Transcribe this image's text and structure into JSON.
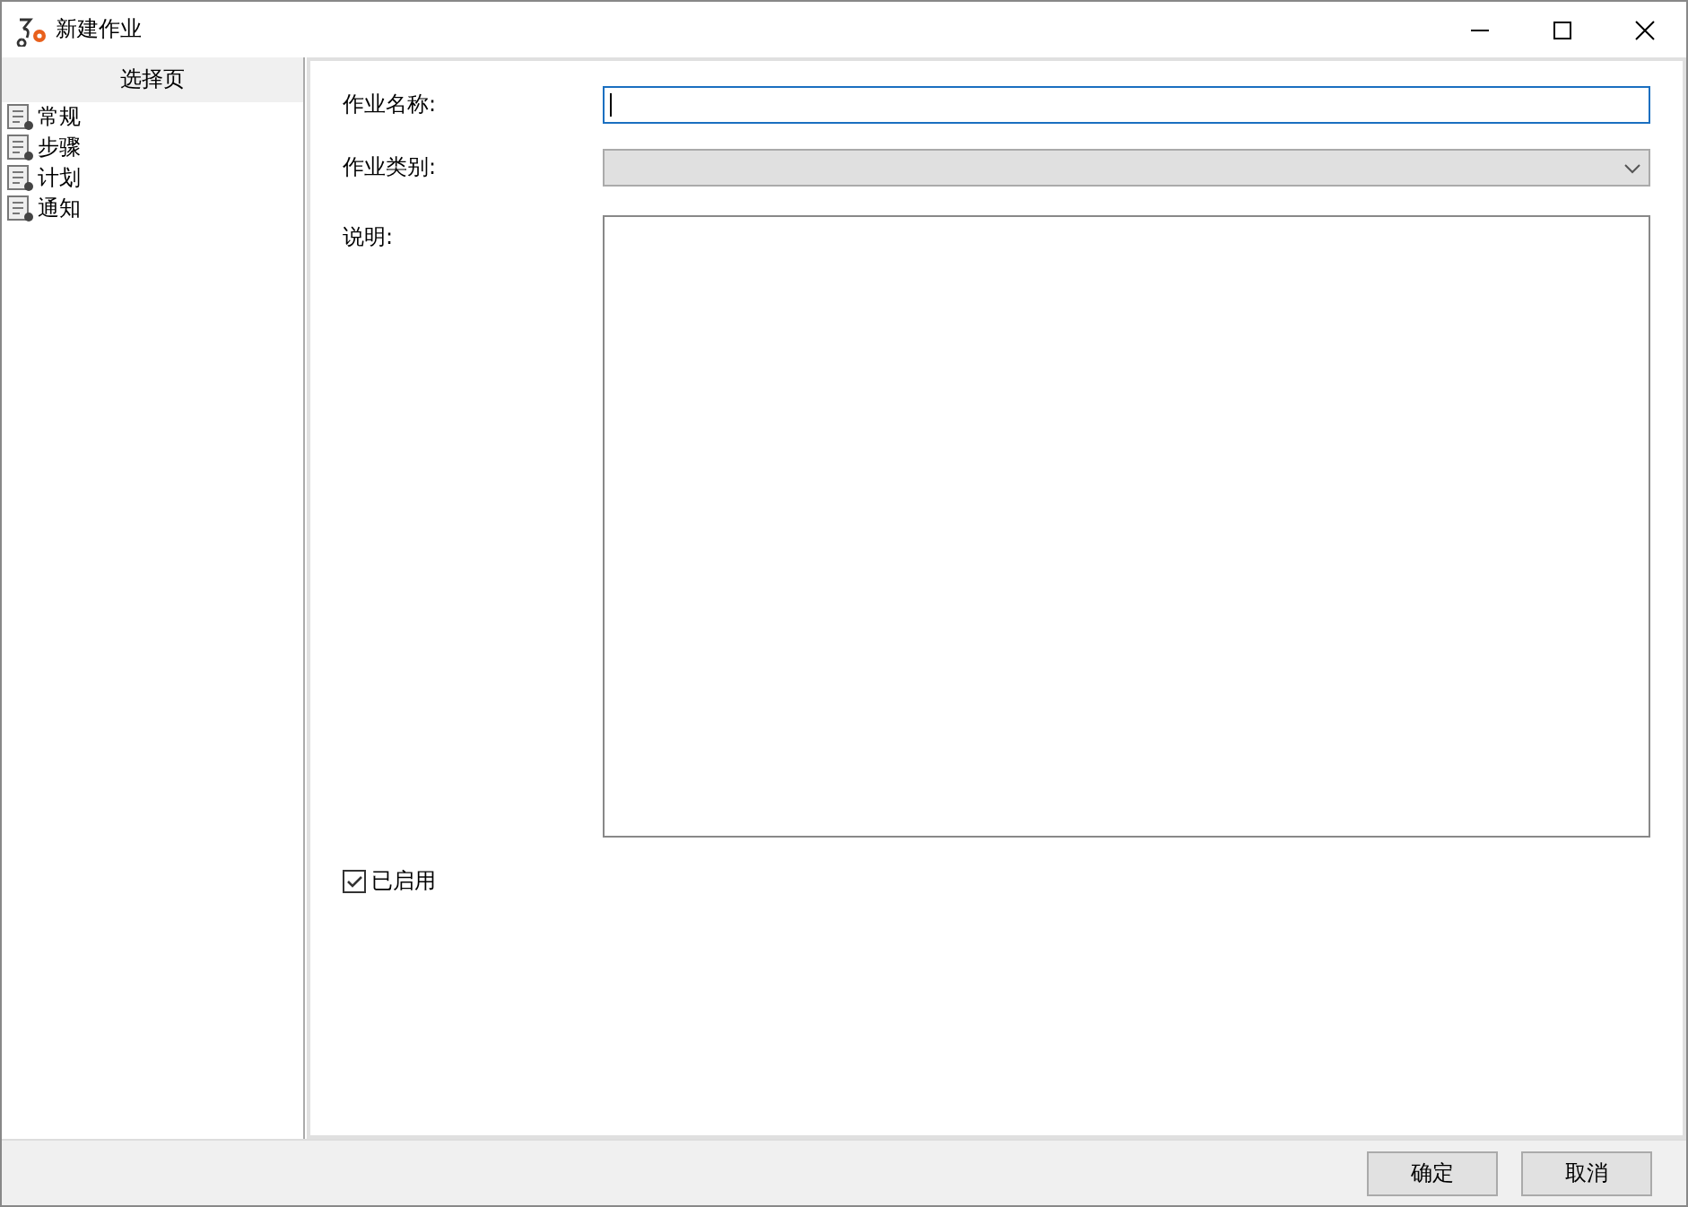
{
  "window": {
    "title": "新建作业"
  },
  "sidebar": {
    "header": "选择页",
    "items": [
      {
        "label": "常规"
      },
      {
        "label": "步骤"
      },
      {
        "label": "计划"
      },
      {
        "label": "通知"
      }
    ]
  },
  "form": {
    "name_label": "作业名称:",
    "category_label": "作业类别:",
    "category_disabled": true,
    "description_label": "说明:",
    "enabled": {
      "label": "已启用",
      "checked": true
    }
  },
  "buttons": [
    "确定",
    "取消"
  ]
}
